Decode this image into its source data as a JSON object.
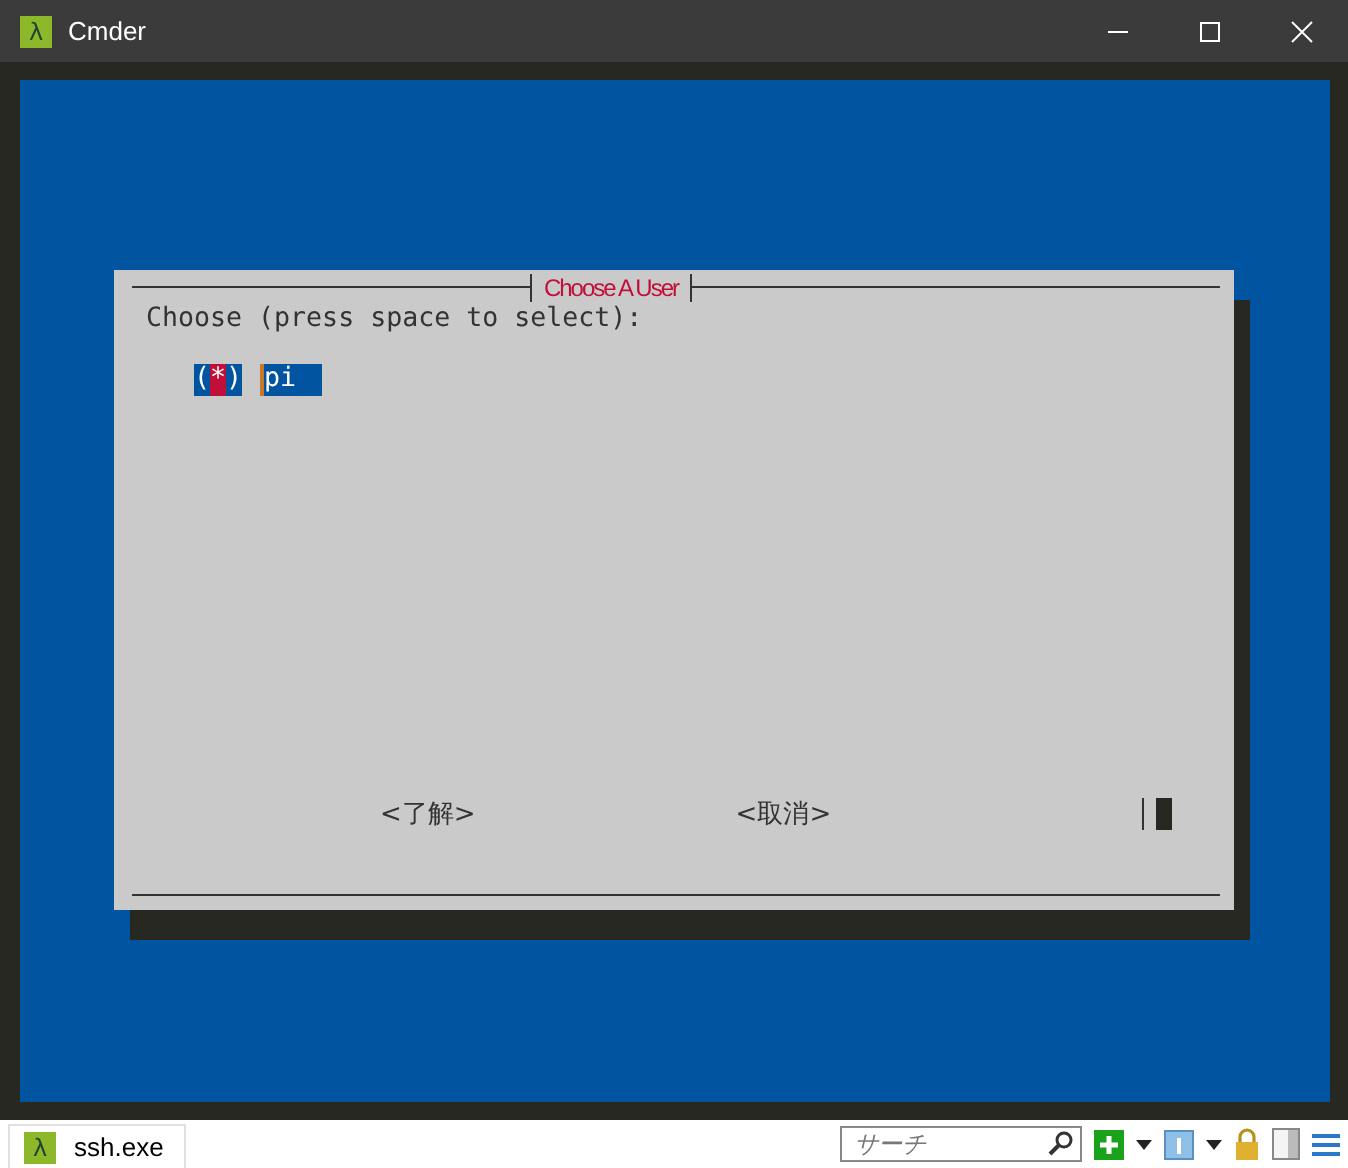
{
  "window": {
    "title": "Cmder",
    "app_glyph": "λ"
  },
  "dialog": {
    "title": "Choose A User",
    "prompt": "Choose (press space to select):",
    "options": [
      {
        "label": "pi",
        "open": "(",
        "mark": "*",
        "close": ")",
        "selected": true
      }
    ],
    "buttons": [
      {
        "label": "<了解>"
      },
      {
        "label": "<取消>"
      }
    ]
  },
  "status_bar": {
    "tabs": [
      {
        "label": "ssh.exe",
        "glyph": "λ",
        "selected": true
      }
    ],
    "search": {
      "placeholder": "サーチ"
    }
  }
}
